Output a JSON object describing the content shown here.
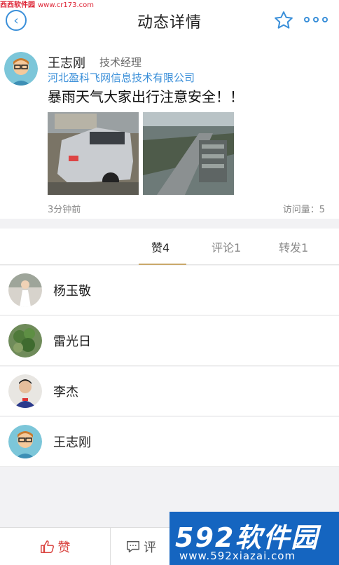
{
  "watermark_top": {
    "brand": "西西软件园",
    "url": "www.cr173.com"
  },
  "header": {
    "title": "动态详情"
  },
  "post": {
    "author": "王志刚",
    "role": "技术经理",
    "company": "河北盈科飞网信息技术有限公司",
    "content": "暴雨天气大家出行注意安全！！",
    "time": "3分钟前",
    "visits": "访问量：5"
  },
  "tabs": [
    {
      "label": "赞4"
    },
    {
      "label": "评论1"
    },
    {
      "label": "转发1"
    }
  ],
  "likers": [
    {
      "name": "杨玉敬"
    },
    {
      "name": "雷光日"
    },
    {
      "name": "李杰"
    },
    {
      "name": "王志刚"
    }
  ],
  "bottom": {
    "like": "赞",
    "comment": "评"
  },
  "watermark_logo": {
    "big": "592软件园",
    "url": "www.592xiazai.com"
  },
  "colors": {
    "accent": "#3a8fd9",
    "like_red": "#d9423e",
    "tab_underline": "#c9a86a"
  },
  "icons": [
    "back-arrow-icon",
    "star-icon",
    "more-dots-icon",
    "thumbs-up-icon",
    "comment-icon"
  ]
}
